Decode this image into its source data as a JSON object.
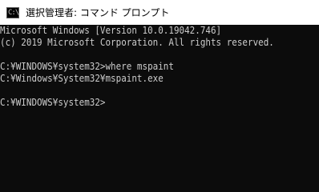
{
  "window": {
    "title": "選択管理者: コマンド プロンプト",
    "icon": "cmd-icon",
    "icon_glyph": "C:\\"
  },
  "console": {
    "lines": [
      "Microsoft Windows [Version 10.0.19042.746]",
      "(c) 2019 Microsoft Corporation. All rights reserved.",
      "",
      "C:¥WINDOWS¥system32>where mspaint",
      "C:¥Windows¥System32¥mspaint.exe",
      "",
      "C:¥WINDOWS¥system32>"
    ]
  },
  "colors": {
    "console_background": "#0c0c0c",
    "console_text": "#cccccc",
    "titlebar_background": "#ffffff"
  }
}
